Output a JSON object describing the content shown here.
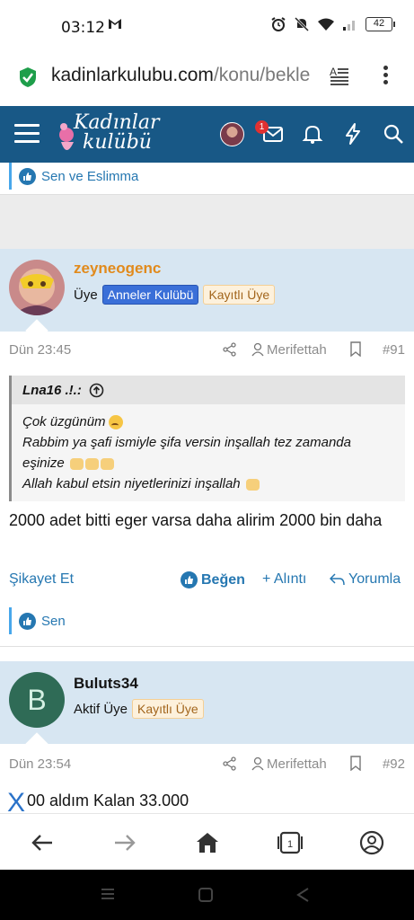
{
  "status_bar": {
    "time": "03:12",
    "notification_icon": "gmail-icon",
    "battery_level": "42",
    "icons": [
      "alarm-icon",
      "mute-icon",
      "wifi-icon",
      "signal-icon",
      "battery-icon"
    ]
  },
  "browser": {
    "url_domain": "kadinlarkulubu.com",
    "url_path": "/konu/bekle",
    "reader_icon": "reader-mode-icon",
    "menu_icon": "more-vert-icon"
  },
  "site_header": {
    "logo_line1": "Kadınlar",
    "logo_line2": "kulübü",
    "messages_badge": "1",
    "colors": {
      "header_bg": "#185886"
    }
  },
  "top_reaction": {
    "text": "Sen ve Eslimma"
  },
  "posts": [
    {
      "username": "zeyneogenc",
      "role": "Üye",
      "tags": [
        "Anneler Kulübü",
        "Kayıtlı Üye"
      ],
      "date": "Dün 23:45",
      "author": "Merifettah",
      "number": "#91",
      "quote": {
        "author": "Lna16 .!.:",
        "lines": [
          "Çok üzgünüm",
          "Rabbim ya şafi ismiyle şifa versin inşallah tez zamanda eşinize",
          "Allah kabul etsin niyetlerinizi inşallah"
        ]
      },
      "text": "2000 adet bitti eger varsa daha alirim 2000 bin daha",
      "actions": {
        "report": "Şikayet Et",
        "like": "Beğen",
        "quote": "+ Alıntı",
        "reply": "Yorumla"
      },
      "reaction": "Sen"
    },
    {
      "username": "Buluts34",
      "avatar_letter": "B",
      "role": "Aktif Üye",
      "tags": [
        "Kayıtlı Üye"
      ],
      "date": "Dün 23:54",
      "author": "Merifettah",
      "number": "#92",
      "text": "00 aldım Kalan 33.000"
    }
  ],
  "floating": {
    "close": "X"
  },
  "bottom_nav": [
    "back-icon",
    "forward-icon",
    "home-icon",
    "tabs-icon",
    "account-icon"
  ],
  "bottom_nav_tabs_count": "1"
}
